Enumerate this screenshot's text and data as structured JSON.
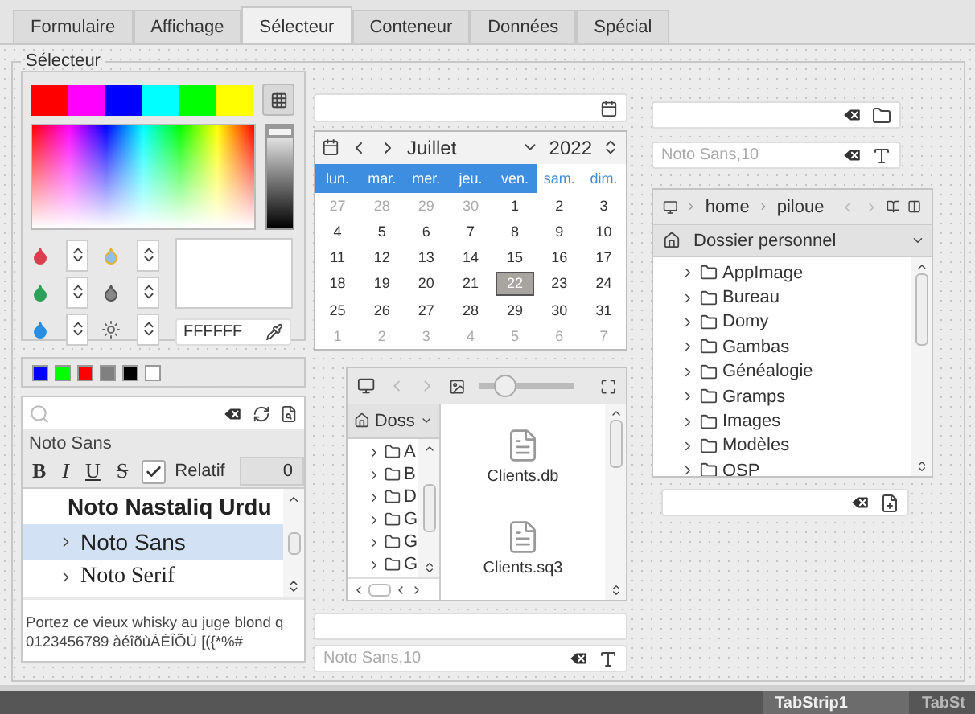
{
  "tabs": [
    {
      "label": "Formulaire",
      "selected": false
    },
    {
      "label": "Affichage",
      "selected": false
    },
    {
      "label": "Sélecteur",
      "selected": true
    },
    {
      "label": "Conteneur",
      "selected": false
    },
    {
      "label": "Données",
      "selected": false
    },
    {
      "label": "Spécial",
      "selected": false
    }
  ],
  "group": {
    "title": "Sélecteur"
  },
  "color_chooser": {
    "palette": [
      {
        "color": "#ff0000"
      },
      {
        "color": "#ff00ff"
      },
      {
        "color": "#0000ff"
      },
      {
        "color": "#00ffff"
      },
      {
        "color": "#00ff00"
      },
      {
        "color": "#ffff00"
      }
    ],
    "hex_value": "FFFFFF",
    "brightness": {
      "level": 1
    }
  },
  "swatches": [
    {
      "color": "#0000ff"
    },
    {
      "color": "#00ff00"
    },
    {
      "color": "#ff0000"
    },
    {
      "color": "#808080"
    },
    {
      "color": "#000000"
    },
    {
      "color": "#ffffff"
    }
  ],
  "font_chooser": {
    "font_name": "Noto Sans",
    "styles": [
      {
        "label": "B",
        "kind": "bold"
      },
      {
        "label": "I",
        "kind": "italic"
      },
      {
        "label": "U",
        "kind": "underline"
      },
      {
        "label": "S",
        "kind": "strike"
      }
    ],
    "relative": {
      "label": "Relatif",
      "checked": true
    },
    "size": "0",
    "fonts": [
      {
        "label": "Noto Nastaliq Urdu",
        "kind": "nastaliq",
        "expandable": false,
        "selected": false
      },
      {
        "label": "Noto Sans",
        "kind": "sans",
        "expandable": true,
        "selected": true
      },
      {
        "label": "Noto Serif",
        "kind": "serif",
        "expandable": true,
        "selected": false
      }
    ],
    "preview": [
      "Portez ce vieux whisky au juge blond q",
      "0123456789 àéîõùÀÉÎÕÙ [({*%#"
    ]
  },
  "calendar": {
    "month": "Juillet",
    "year": "2022",
    "weekdays": [
      {
        "label": "lun.",
        "weekend": false
      },
      {
        "label": "mar.",
        "weekend": false
      },
      {
        "label": "mer.",
        "weekend": false
      },
      {
        "label": "jeu.",
        "weekend": false
      },
      {
        "label": "ven.",
        "weekend": false
      },
      {
        "label": "sam.",
        "weekend": true
      },
      {
        "label": "dim.",
        "weekend": true
      }
    ],
    "weeks": [
      [
        {
          "day": "27",
          "outside": true,
          "selected": false
        },
        {
          "day": "28",
          "outside": true,
          "selected": false
        },
        {
          "day": "29",
          "outside": true,
          "selected": false
        },
        {
          "day": "30",
          "outside": true,
          "selected": false
        },
        {
          "day": "1",
          "outside": false,
          "selected": false
        },
        {
          "day": "2",
          "outside": false,
          "selected": false
        },
        {
          "day": "3",
          "outside": false,
          "selected": false
        }
      ],
      [
        {
          "day": "4",
          "outside": false,
          "selected": false
        },
        {
          "day": "5",
          "outside": false,
          "selected": false
        },
        {
          "day": "6",
          "outside": false,
          "selected": false
        },
        {
          "day": "7",
          "outside": false,
          "selected": false
        },
        {
          "day": "8",
          "outside": false,
          "selected": false
        },
        {
          "day": "9",
          "outside": false,
          "selected": false
        },
        {
          "day": "10",
          "outside": false,
          "selected": false
        }
      ],
      [
        {
          "day": "11",
          "outside": false,
          "selected": false
        },
        {
          "day": "12",
          "outside": false,
          "selected": false
        },
        {
          "day": "13",
          "outside": false,
          "selected": false
        },
        {
          "day": "14",
          "outside": false,
          "selected": false
        },
        {
          "day": "15",
          "outside": false,
          "selected": false
        },
        {
          "day": "16",
          "outside": false,
          "selected": false
        },
        {
          "day": "17",
          "outside": false,
          "selected": false
        }
      ],
      [
        {
          "day": "18",
          "outside": false,
          "selected": false
        },
        {
          "day": "19",
          "outside": false,
          "selected": false
        },
        {
          "day": "20",
          "outside": false,
          "selected": false
        },
        {
          "day": "21",
          "outside": false,
          "selected": false
        },
        {
          "day": "22",
          "outside": false,
          "selected": true
        },
        {
          "day": "23",
          "outside": false,
          "selected": false
        },
        {
          "day": "24",
          "outside": false,
          "selected": false
        }
      ],
      [
        {
          "day": "25",
          "outside": false,
          "selected": false
        },
        {
          "day": "26",
          "outside": false,
          "selected": false
        },
        {
          "day": "27",
          "outside": false,
          "selected": false
        },
        {
          "day": "28",
          "outside": false,
          "selected": false
        },
        {
          "day": "29",
          "outside": false,
          "selected": false
        },
        {
          "day": "30",
          "outside": false,
          "selected": false
        },
        {
          "day": "31",
          "outside": false,
          "selected": false
        }
      ],
      [
        {
          "day": "1",
          "outside": true,
          "selected": false
        },
        {
          "day": "2",
          "outside": true,
          "selected": false
        },
        {
          "day": "3",
          "outside": true,
          "selected": false
        },
        {
          "day": "4",
          "outside": true,
          "selected": false
        },
        {
          "day": "5",
          "outside": true,
          "selected": false
        },
        {
          "day": "6",
          "outside": true,
          "selected": false
        },
        {
          "day": "7",
          "outside": true,
          "selected": false
        }
      ]
    ]
  },
  "file_view": {
    "place": "Doss",
    "tree": [
      {
        "label": "A"
      },
      {
        "label": "B"
      },
      {
        "label": "D"
      },
      {
        "label": "G"
      },
      {
        "label": "G"
      },
      {
        "label": "G"
      }
    ],
    "files": [
      {
        "name": "Clients.db"
      },
      {
        "name": "Clients.sq3"
      }
    ],
    "icon_size": {
      "level": 0.28
    }
  },
  "font_field_center": {
    "placeholder": "Noto Sans,10"
  },
  "font_field_right": {
    "placeholder": "Noto Sans,10"
  },
  "file_chooser": {
    "path": [
      "home",
      "piloue"
    ],
    "place": "Dossier personnel",
    "folders": [
      {
        "label": "AppImage"
      },
      {
        "label": "Bureau"
      },
      {
        "label": "Domy"
      },
      {
        "label": "Gambas"
      },
      {
        "label": "Généalogie"
      },
      {
        "label": "Gramps"
      },
      {
        "label": "Images"
      },
      {
        "label": "Modèles"
      },
      {
        "label": "OSP"
      }
    ]
  },
  "status_bar": {
    "tabs": [
      {
        "label": "TabStrip1",
        "selected": true
      },
      {
        "label": "TabSt",
        "selected": false
      }
    ]
  }
}
